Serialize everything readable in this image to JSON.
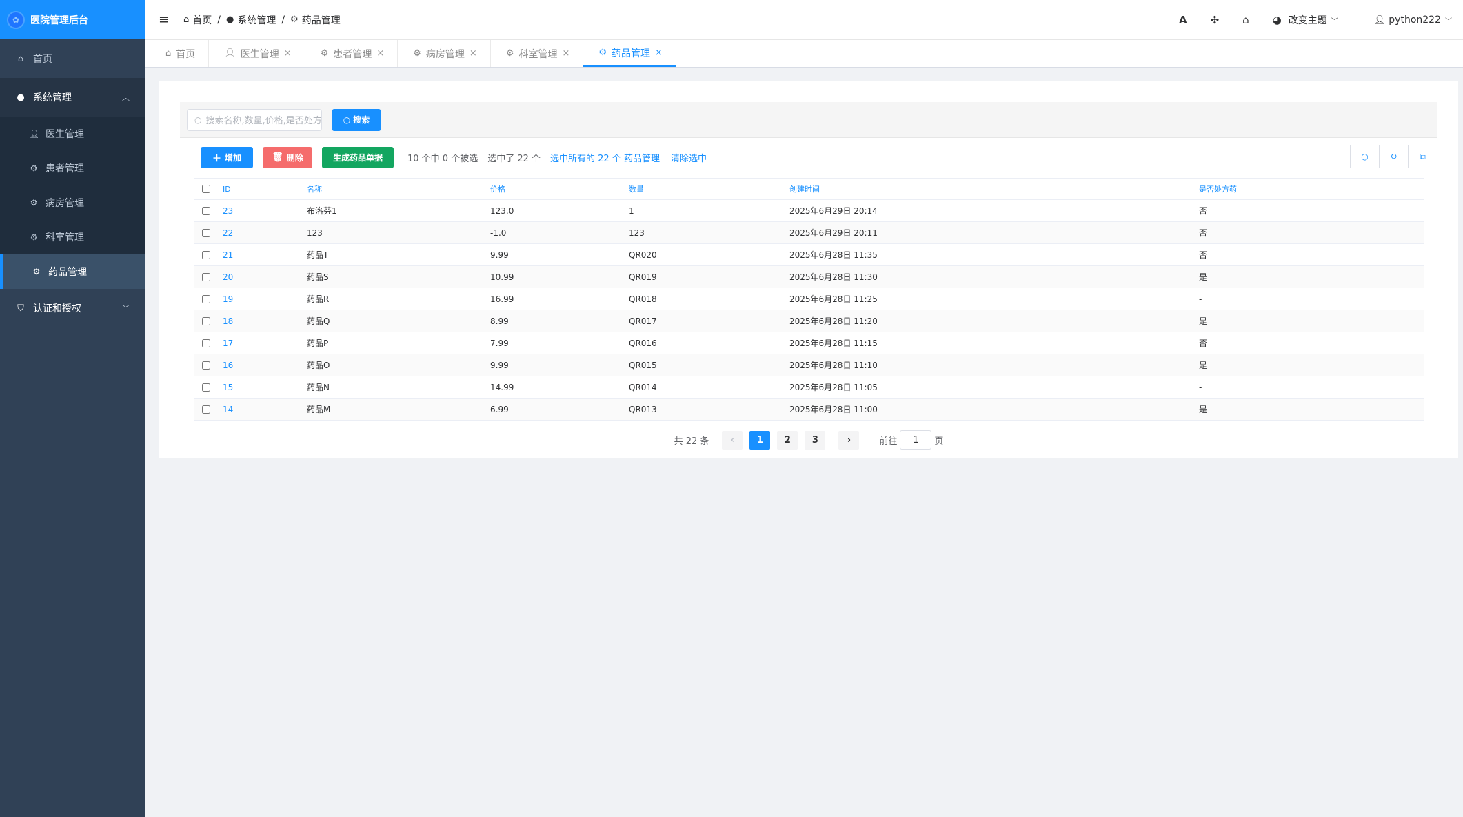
{
  "app": {
    "title": "医院管理后台",
    "logo_icon": "logo-circle"
  },
  "sidebar": {
    "home": "首页",
    "system": {
      "label": "系统管理",
      "expanded": true
    },
    "items": [
      {
        "label": "医生管理",
        "icon": "user-icon"
      },
      {
        "label": "患者管理",
        "icon": "gear-icon"
      },
      {
        "label": "病房管理",
        "icon": "gear-icon"
      },
      {
        "label": "科室管理",
        "icon": "gear-icon"
      },
      {
        "label": "药品管理",
        "icon": "gear-icon",
        "active": true
      }
    ],
    "auth": "认证和授权"
  },
  "header": {
    "breadcrumb": [
      "首页",
      "系统管理",
      "药品管理"
    ],
    "theme": "改变主题",
    "user": "python222",
    "font_icon": "A"
  },
  "tabs": [
    {
      "label": "首页",
      "closable": false
    },
    {
      "label": "医生管理",
      "closable": true
    },
    {
      "label": "患者管理",
      "closable": true
    },
    {
      "label": "病房管理",
      "closable": true
    },
    {
      "label": "科室管理",
      "closable": true
    },
    {
      "label": "药品管理",
      "closable": true,
      "active": true
    }
  ],
  "search": {
    "placeholder": "搜索名称,数量,价格,是否处方药",
    "button": "搜索"
  },
  "toolbar": {
    "add": "增加",
    "delete": "删除",
    "generate": "生成药品单据",
    "selected_info": "10 个中 0 个被选",
    "selected_total": "选中了 22 个",
    "select_all": "选中所有的 22 个 药品管理",
    "clear": "清除选中"
  },
  "table": {
    "headers": [
      "ID",
      "名称",
      "价格",
      "数量",
      "创建时间",
      "是否处方药"
    ],
    "rows": [
      {
        "id": "23",
        "name": "布洛芬1",
        "price": "123.0",
        "qty": "1",
        "date": "2025年6月29日 20:14",
        "rx": "否"
      },
      {
        "id": "22",
        "name": "123",
        "price": "-1.0",
        "qty": "123",
        "date": "2025年6月29日 20:11",
        "rx": "否"
      },
      {
        "id": "21",
        "name": "药品T",
        "price": "9.99",
        "qty": "QR020",
        "date": "2025年6月28日 11:35",
        "rx": "否"
      },
      {
        "id": "20",
        "name": "药品S",
        "price": "10.99",
        "qty": "QR019",
        "date": "2025年6月28日 11:30",
        "rx": "是"
      },
      {
        "id": "19",
        "name": "药品R",
        "price": "16.99",
        "qty": "QR018",
        "date": "2025年6月28日 11:25",
        "rx": "-"
      },
      {
        "id": "18",
        "name": "药品Q",
        "price": "8.99",
        "qty": "QR017",
        "date": "2025年6月28日 11:20",
        "rx": "是"
      },
      {
        "id": "17",
        "name": "药品P",
        "price": "7.99",
        "qty": "QR016",
        "date": "2025年6月28日 11:15",
        "rx": "否"
      },
      {
        "id": "16",
        "name": "药品O",
        "price": "9.99",
        "qty": "QR015",
        "date": "2025年6月28日 11:10",
        "rx": "是"
      },
      {
        "id": "15",
        "name": "药品N",
        "price": "14.99",
        "qty": "QR014",
        "date": "2025年6月28日 11:05",
        "rx": "-"
      },
      {
        "id": "14",
        "name": "药品M",
        "price": "6.99",
        "qty": "QR013",
        "date": "2025年6月28日 11:00",
        "rx": "是"
      }
    ]
  },
  "pager": {
    "total": "共 22 条",
    "pages": [
      "1",
      "2",
      "3"
    ],
    "current": "1",
    "goto_label": "前往",
    "goto_value": "1",
    "page_suffix": "页"
  },
  "colors": {
    "primary": "#1890ff",
    "danger": "#f56c6c",
    "success": "#13a660",
    "sidebar": "#304156"
  }
}
